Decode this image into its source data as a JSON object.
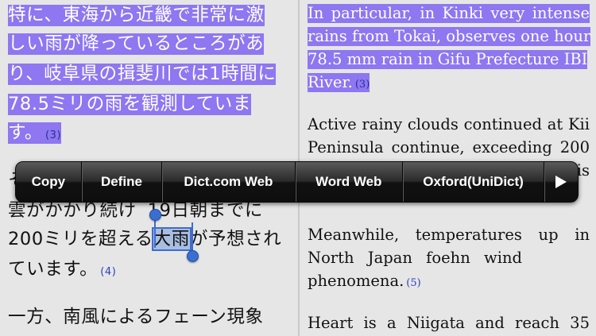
{
  "left": {
    "para1": [
      "特に、東海から近畿で非常に激",
      "しい雨が降っているところがあ",
      "り、岐阜県の揖斐川では1時間に",
      "78.5ミリの雨を観測していま",
      "す。"
    ],
    "para1_ref": "(3)",
    "line_partial": "そ",
    "para2_line1_a": "雲がかかり続け",
    "para2_line1_b": "19日朝までに",
    "para2_line2_a": "200ミリを超える",
    "para2_line2_sel": "大雨",
    "para2_line2_b": "が予想され",
    "para2_line3": "ています。",
    "para2_ref": "(4)",
    "para3_line1": "一方、南風によるフェーン現象"
  },
  "right": {
    "para1": [
      "In particular, in Kinki very intense",
      "rains from Tokai, observes one hour",
      "78.5 mm rain in Gifu Prefecture IBI",
      "River."
    ],
    "para1_ref": "(3)",
    "para2": [
      "Active rainy clouds continued at Kii",
      "Peninsula continue, exceeding 200"
    ],
    "para2_partial_end": "is",
    "para3": [
      "Meanwhile, temperatures up in",
      "North Japan foehn wind",
      "phenomena."
    ],
    "para3_ref": "(5)",
    "para4_line1": "Heart is a Niigata and reach 35"
  },
  "toolbar": {
    "copy": "Copy",
    "define": "Define",
    "dict": "Dict.com Web",
    "word": "Word Web",
    "oxford": "Oxford(UniDict)",
    "more_icon": "play-triangle-icon"
  },
  "colors": {
    "highlight": "#8e77f0",
    "selection": "#a8bde0",
    "handle": "#3a6fd1",
    "ref_link": "#2d3fbf"
  }
}
